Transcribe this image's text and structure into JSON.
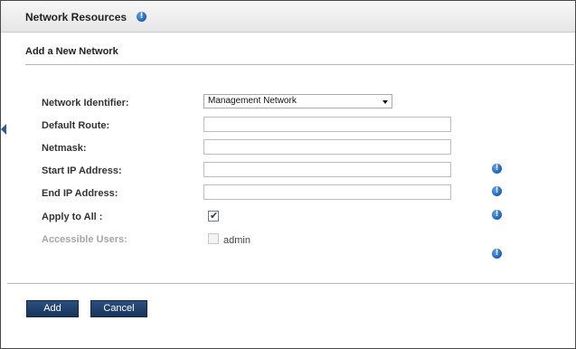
{
  "window": {
    "title": "Network Resources"
  },
  "dialog": {
    "section_title": "Add a New Network",
    "fields": {
      "network_identifier": {
        "label": "Network Identifier:",
        "value": "Management Network"
      },
      "default_route": {
        "label": "Default Route:",
        "value": ""
      },
      "netmask": {
        "label": "Netmask:",
        "value": ""
      },
      "start_ip": {
        "label": "Start IP Address:",
        "value": ""
      },
      "end_ip": {
        "label": "End IP Address:",
        "value": ""
      },
      "apply_to_all": {
        "label": "Apply to All :",
        "checked": true
      },
      "accessible_users": {
        "label": "Accessible Users:",
        "option_label": "admin",
        "checked": false,
        "disabled": true
      }
    },
    "buttons": {
      "add": "Add",
      "cancel": "Cancel"
    }
  },
  "icons": {
    "info": "info-icon",
    "check": "checkmark-icon",
    "dropdown": "chevron-down-icon",
    "left_tab": "chevron-left-icon"
  },
  "colors": {
    "button_bg": "#1f3f6b",
    "info_icon": "#1a5fb4",
    "border": "#4a4a4a"
  }
}
